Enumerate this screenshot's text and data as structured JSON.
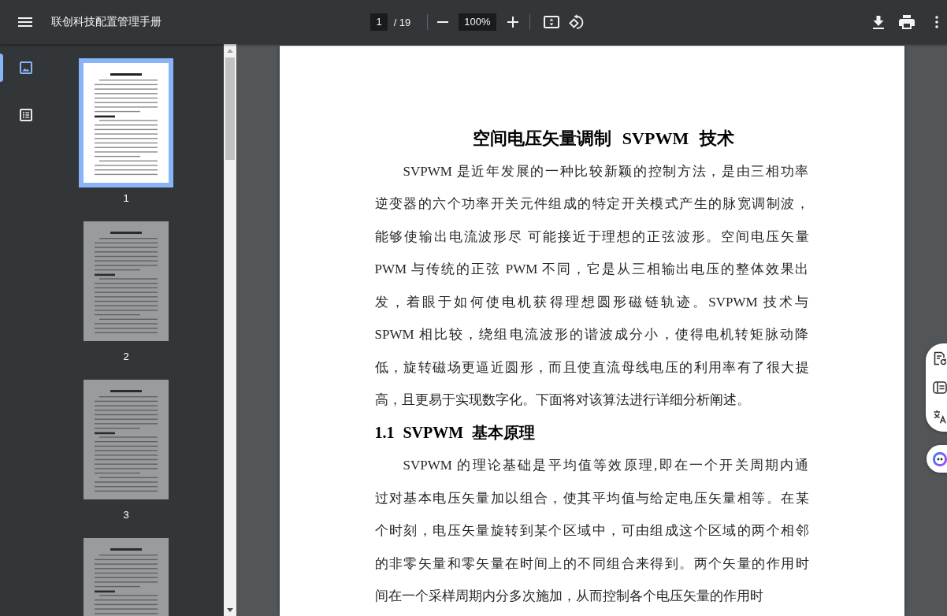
{
  "toolbar": {
    "title": "联创科技配置管理手册",
    "page_number": "1",
    "page_total": "/ 19",
    "zoom": "100%"
  },
  "sidebar": {
    "views": [
      {
        "kind": "thumbnails",
        "selected": true
      },
      {
        "kind": "outline",
        "selected": false
      }
    ],
    "thumbnails": [
      {
        "label": "1",
        "selected": true
      },
      {
        "label": "2",
        "selected": false
      },
      {
        "label": "3",
        "selected": false
      },
      {
        "selected": false
      }
    ]
  },
  "document": {
    "title": "空间电压矢量调制 SVPWM 技术",
    "blocks": [
      {
        "kind": "paragraph",
        "lines": [
          "SVPWM 是近年发展的一种比较新颖的控制方法，是由三相功率",
          "逆变器的六个功率开关元件组成的特定开关模式产生的脉宽调制波，",
          "能够使输出电流波形尽 可能接近于理想的正弦波形。空间电压矢量",
          "PWM 与传统的正弦 PWM 不同，它是从三相输出电压的整体效果出",
          "发，着眼于如何使电机获得理想圆形磁链轨迹。SVPWM 技术与",
          "SPWM 相比较，绕组电流波形的谐波成分小，使得电机转矩脉动降",
          "低，旋转磁场更逼近圆形，而且使直流母线电压的利用率有了很大提",
          "高，且更易于实现数字化。下面将对该算法进行详细分析阐述。"
        ]
      },
      {
        "kind": "heading",
        "text": "1.1 SVPWM 基本原理"
      },
      {
        "kind": "paragraph",
        "lines": [
          "SVPWM 的理论基础是平均值等效原理,即在一个开关周期内通",
          "过对基本电压矢量加以组合，使其平均值与给定电压矢量相等。在某",
          "个时刻，电压矢量旋转到某个区域中，可由组成这个区域的两个相邻",
          "的非零矢量和零矢量在时间上的不同组合来得到。两个矢量的作用时",
          "间在一个采样周期内分多次施加，从而控制各个电压矢量的作用时"
        ]
      }
    ]
  }
}
